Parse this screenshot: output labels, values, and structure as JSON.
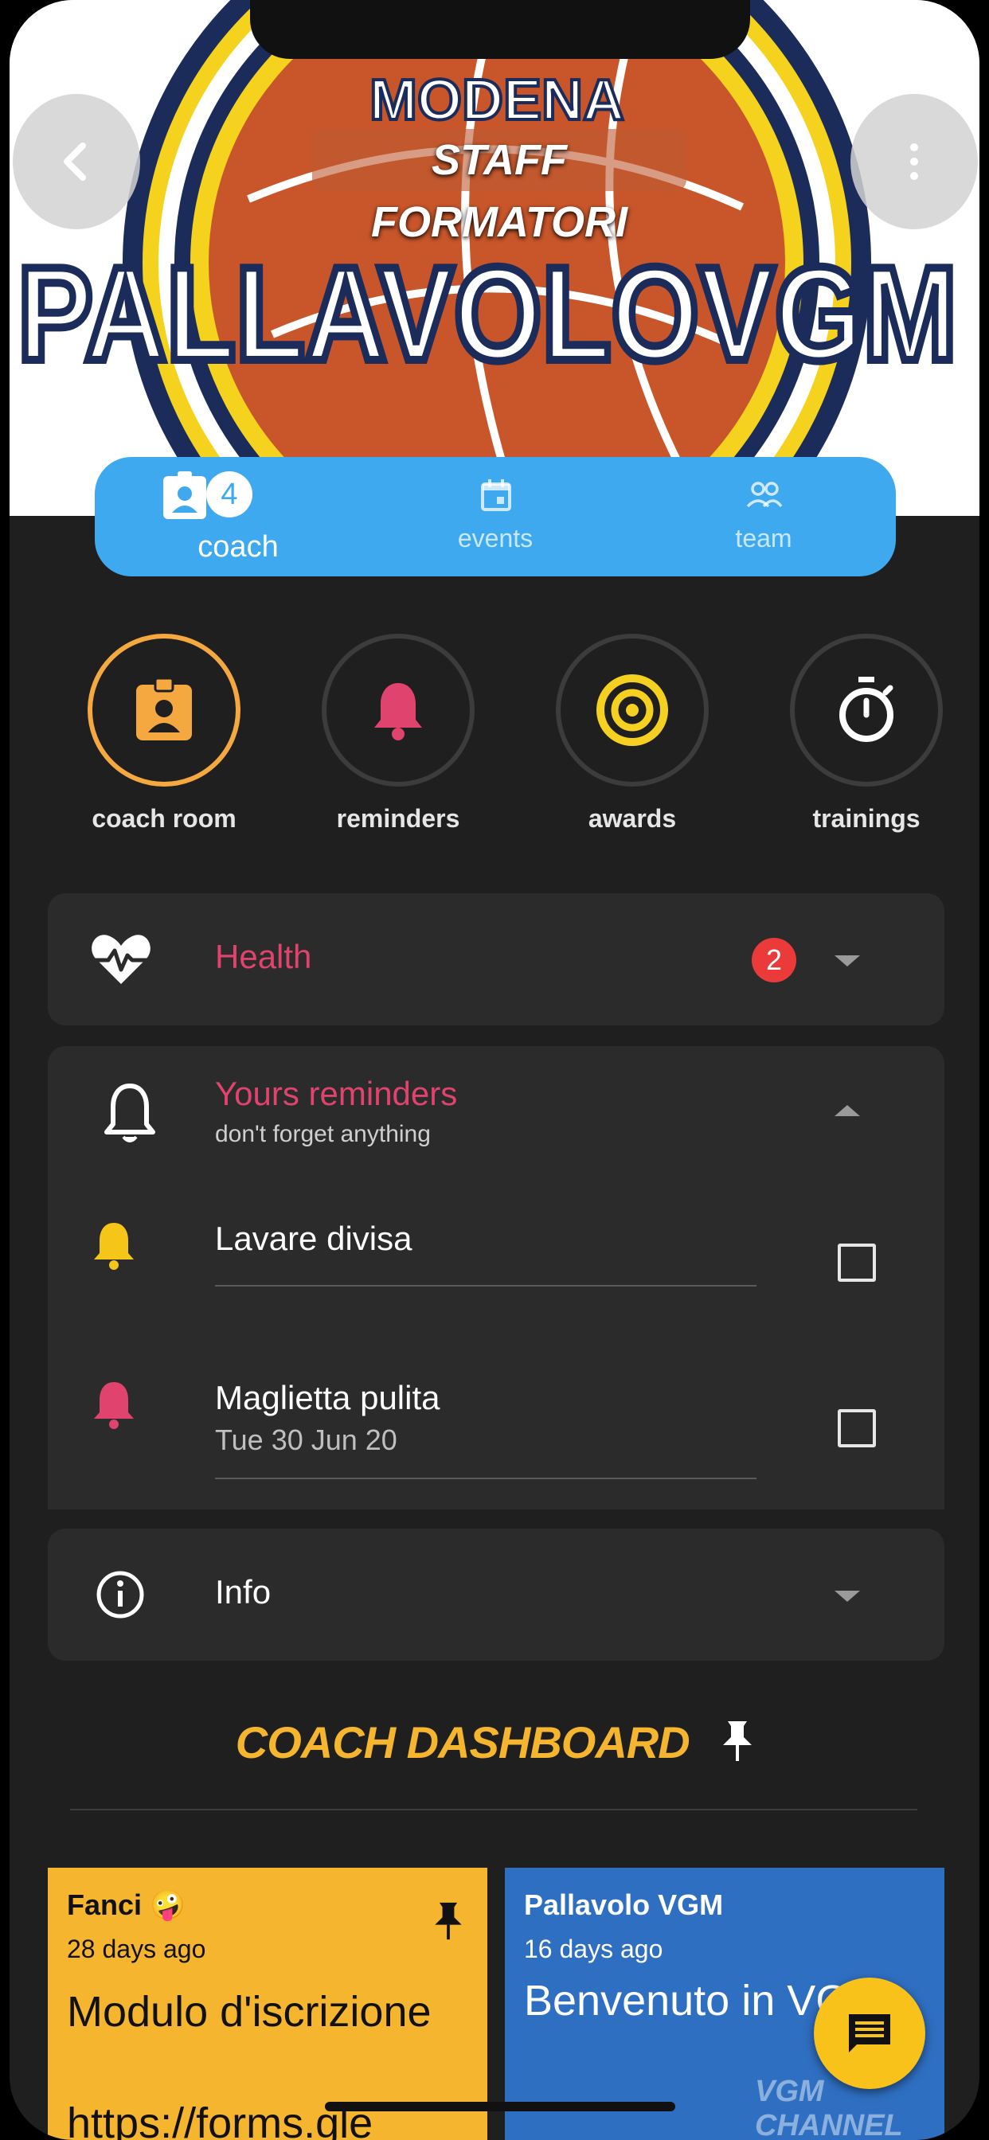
{
  "header": {
    "logo_wordmark": "PALLAVOLOVGM",
    "logo_top_text": "MODENA",
    "subtitle": "STAFF FORMATORI",
    "back_icon": "chevron-left-icon",
    "menu_icon": "more-vertical-icon"
  },
  "tabs": [
    {
      "label": "coach",
      "icon": "badge-icon",
      "badge": "4",
      "active": true
    },
    {
      "label": "events",
      "icon": "calendar-icon",
      "active": false
    },
    {
      "label": "team",
      "icon": "group-icon",
      "active": false
    }
  ],
  "quick_actions": [
    {
      "label": "coach room",
      "icon": "badge-icon",
      "color": "#f5a840",
      "active": true
    },
    {
      "label": "reminders",
      "icon": "bell-icon",
      "color": "#e0436e",
      "active": false
    },
    {
      "label": "awards",
      "icon": "target-icon",
      "color": "#f5d020",
      "active": false
    },
    {
      "label": "trainings",
      "icon": "stopwatch-icon",
      "color": "#ffffff",
      "active": false
    }
  ],
  "health": {
    "title": "Health",
    "badge": "2",
    "icon": "heart-pulse-icon"
  },
  "reminders": {
    "title": "Yours reminders",
    "subtitle": "don't forget anything",
    "icon": "bell-outline-icon",
    "items": [
      {
        "title": "Lavare divisa",
        "date": "",
        "bell_color": "#f5c518"
      },
      {
        "title": "Maglietta pulita",
        "date": "Tue 30 Jun 20",
        "bell_color": "#e0436e"
      }
    ]
  },
  "info": {
    "title": "Info",
    "icon": "info-icon"
  },
  "dashboard": {
    "title": "COACH DASHBOARD",
    "pin_icon": "pin-icon",
    "posts": [
      {
        "author": "Fanci 🤪",
        "ago": "28 days ago",
        "title": "Modulo d'iscrizione",
        "link": "https://forms.gle",
        "bg": "#f5b52e"
      },
      {
        "author": "Pallavolo VGM",
        "ago": "16 days ago",
        "title": "Benvenuto in VGM!",
        "watermark": "VGM CHANNEL",
        "bg": "#2f6fc2"
      }
    ]
  },
  "fab": {
    "icon": "chat-icon"
  },
  "colors": {
    "accent_blue": "#3fa9f0",
    "accent_pink": "#e0436e",
    "accent_orange": "#f5a840",
    "accent_yellow": "#f5b52e",
    "background": "#1f1f1f",
    "card": "#2b2b2b"
  }
}
